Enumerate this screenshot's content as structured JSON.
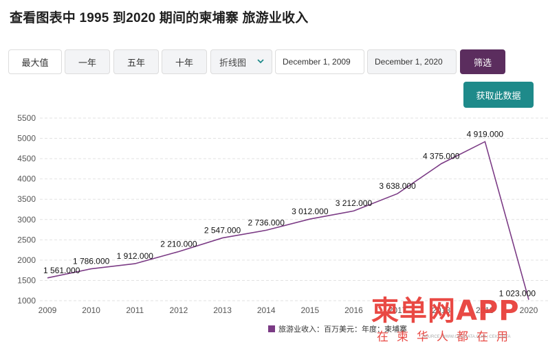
{
  "page": {
    "title": "查看图表中 1995 到2020 期间的柬埔寨 旅游业收入"
  },
  "toolbar": {
    "range_buttons": [
      "最大值",
      "一年",
      "五年",
      "十年"
    ],
    "chart_type": "折线图",
    "start_date": "December 1, 2009",
    "end_date": "December 1, 2020",
    "filter_label": "筛选",
    "get_data_label": "获取此数据"
  },
  "watermark": {
    "main": "柬单网APP",
    "sub": "在柬华人都在用",
    "source": "SOURCE: WWW.CEICDATA.COM | CEIC DATA"
  },
  "chart_data": {
    "type": "line",
    "x": [
      "2009",
      "2010",
      "2011",
      "2012",
      "2013",
      "2014",
      "2015",
      "2016",
      "2017",
      "2018",
      "2019",
      "2020"
    ],
    "series": [
      {
        "name": "旅游业收入：百万美元：年度：柬埔寨",
        "values": [
          1561,
          1786,
          1912,
          2210,
          2547,
          2736,
          3012,
          3212,
          3638,
          4375,
          4919,
          1023
        ],
        "labels": [
          "1 561.000",
          "1 786.000",
          "1 912.000",
          "2 210.000",
          "2 547.000",
          "2 736.000",
          "3 012.000",
          "3 212.000",
          "3 638.000",
          "4 375.000",
          "4 919.000",
          "1 023.000"
        ]
      }
    ],
    "y_ticks": [
      "1000",
      "1500",
      "2000",
      "2500",
      "3000",
      "3500",
      "4000",
      "4500",
      "5000",
      "5500"
    ],
    "ylim": [
      1000,
      5500
    ],
    "grid": true,
    "legend": "bottom-right",
    "color": "#7b3b85"
  }
}
